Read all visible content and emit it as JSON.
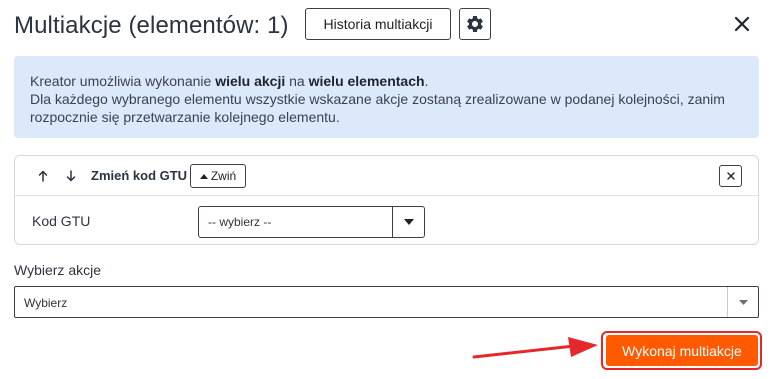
{
  "header": {
    "title": "Multiakcje (elementów: 1)",
    "history_button": "Historia multiakcji",
    "settings_icon": "gear-icon",
    "close_icon": "close-icon"
  },
  "info": {
    "line1_prefix": "Kreator umożliwia wykonanie ",
    "line1_bold1": "wielu akcji",
    "line1_mid": " na ",
    "line1_bold2": "wielu elementach",
    "line1_suffix": ".",
    "line2": "Dla każdego wybranego elementu wszystkie wskazane akcje zostaną zrealizowane w podanej kolejności, zanim rozpocznie się przetwarzanie kolejnego elementu."
  },
  "action_card": {
    "move_up_icon": "arrow-up-icon",
    "move_down_icon": "arrow-down-icon",
    "title": "Zmień kod GTU",
    "collapse_label": "Zwiń",
    "remove_icon": "close-icon",
    "field_label": "Kod GTU",
    "select_value": "-- wybierz --"
  },
  "choose_action": {
    "label": "Wybierz akcje",
    "select_value": "Wybierz"
  },
  "footer": {
    "execute_label": "Wykonaj multiakcje"
  },
  "colors": {
    "info_background": "#dbe9fb",
    "execute_button": "#ff5a00",
    "highlight": "#e5282b"
  }
}
